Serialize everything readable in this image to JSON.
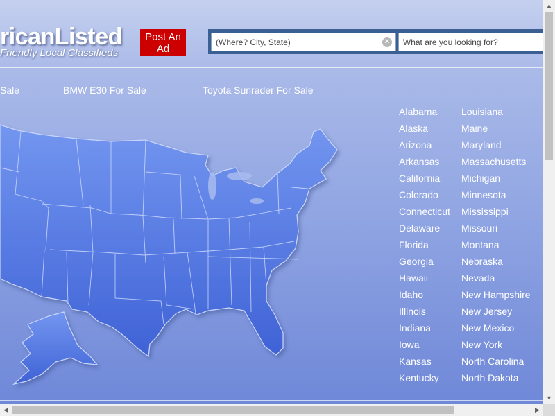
{
  "header": {
    "logo_main": "ricanListed",
    "logo_sub": "Friendly Local Classifieds",
    "post_ad_label": "Post An Ad",
    "search_where_placeholder": "(Where? City, State)",
    "search_what_placeholder": "What are you looking for?"
  },
  "top_links": [
    "Sale",
    "BMW E30 For Sale",
    "Toyota Sunrader For Sale"
  ],
  "states_col1": [
    "Alabama",
    "Alaska",
    "Arizona",
    "Arkansas",
    "California",
    "Colorado",
    "Connecticut",
    "Delaware",
    "Florida",
    "Georgia",
    "Hawaii",
    "Idaho",
    "Illinois",
    "Indiana",
    "Iowa",
    "Kansas",
    "Kentucky"
  ],
  "states_col2": [
    "Louisiana",
    "Maine",
    "Maryland",
    "Massachusetts",
    "Michigan",
    "Minnesota",
    "Mississippi",
    "Missouri",
    "Montana",
    "Nebraska",
    "Nevada",
    "New Hampshire",
    "New Jersey",
    "New Mexico",
    "New York",
    "North Carolina",
    "North Dakota"
  ],
  "icons": {
    "clear": "clear-icon",
    "scroll_up": "arrow-up-icon",
    "scroll_down": "arrow-down-icon",
    "scroll_left": "arrow-left-icon",
    "scroll_right": "arrow-right-icon"
  },
  "colors": {
    "post_button": "#cc0000",
    "search_bar_frame": "#3a5f93",
    "map_fill": "#5b7ee6"
  }
}
